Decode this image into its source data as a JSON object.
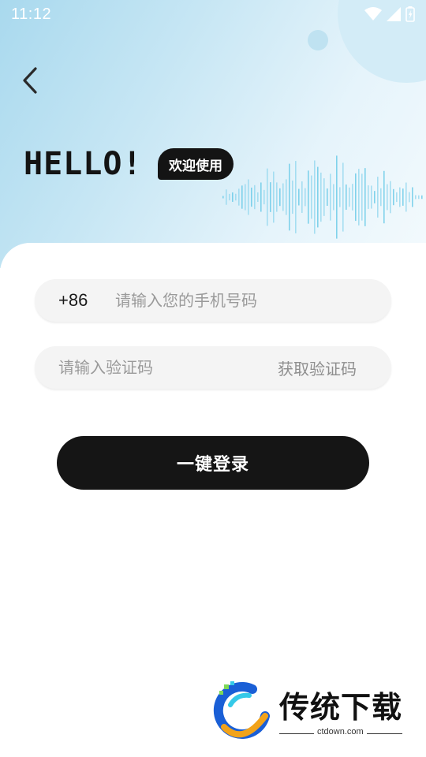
{
  "status_bar": {
    "time": "11:12",
    "icons": [
      "wifi-icon",
      "signal-icon",
      "battery-icon"
    ]
  },
  "nav": {
    "back_icon": "chevron-left-icon"
  },
  "hero": {
    "hello": "HELLO!",
    "welcome": "欢迎使用"
  },
  "form": {
    "country_code": "+86",
    "phone_placeholder": "请输入您的手机号码",
    "phone_value": "",
    "code_placeholder": "请输入验证码",
    "code_value": "",
    "get_code_label": "获取验证码",
    "login_label": "一键登录"
  },
  "watermark": {
    "brand": "传统下载",
    "url": "ctdown.com"
  },
  "colors": {
    "hero_gradient_start": "#a9d9ee",
    "hero_gradient_end": "#f3fafd",
    "button": "#151515",
    "field_bg": "#f4f4f4",
    "placeholder": "#9a9a9a"
  }
}
